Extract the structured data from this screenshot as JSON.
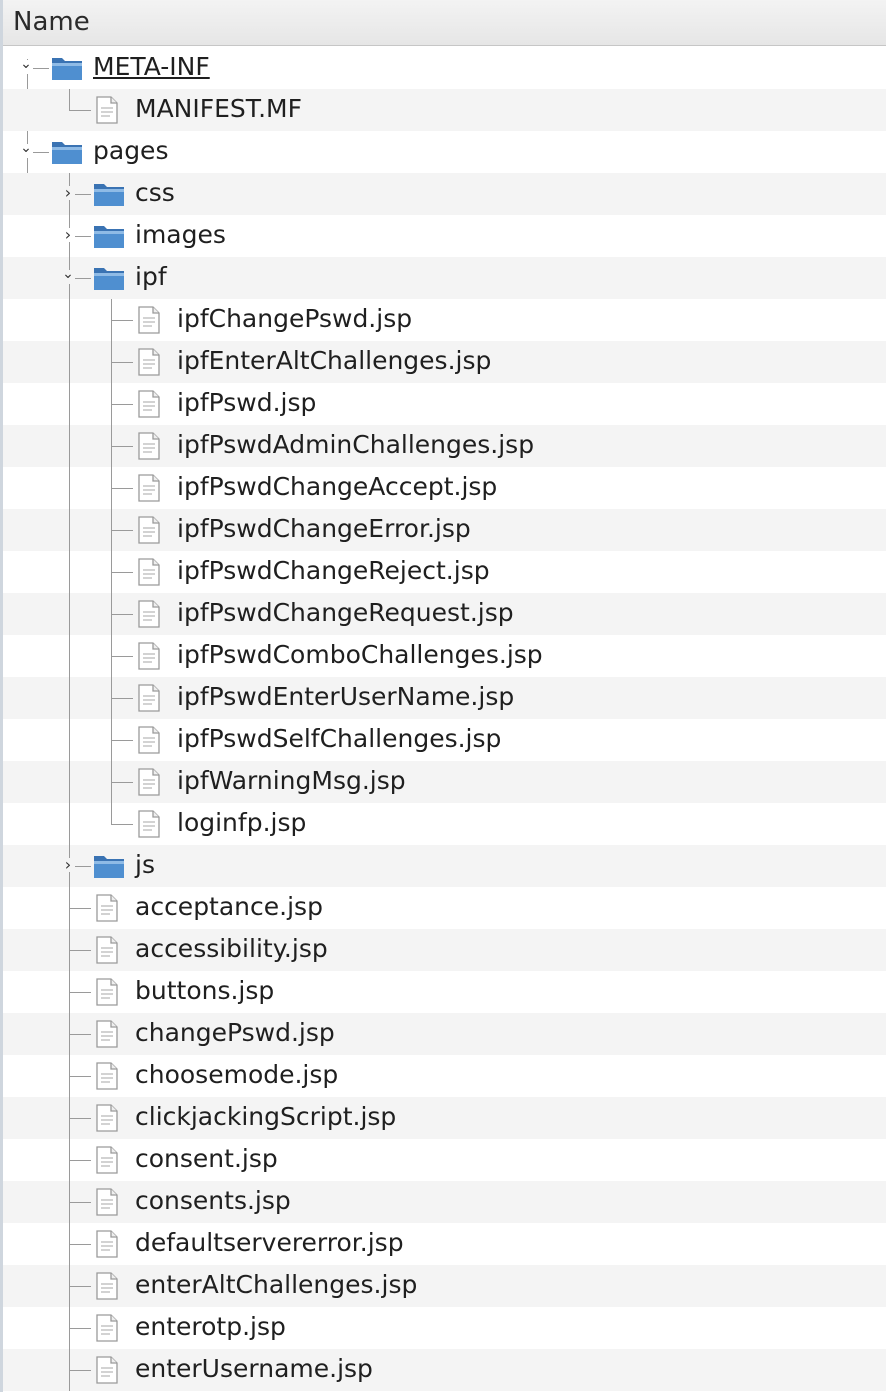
{
  "header": {
    "name_label": "Name"
  },
  "colors": {
    "folder": "#4f8fd0",
    "folder_tab": "#3a73b3",
    "row_alt": "#f4f4f4",
    "tree_line": "#9a9a9a"
  },
  "tree": [
    {
      "label": "META-INF",
      "type": "folder",
      "depth": 0,
      "expanded": true,
      "underline": true
    },
    {
      "label": "MANIFEST.MF",
      "type": "file",
      "depth": 1
    },
    {
      "label": "pages",
      "type": "folder",
      "depth": 0,
      "expanded": true
    },
    {
      "label": "css",
      "type": "folder",
      "depth": 1,
      "expanded": false
    },
    {
      "label": "images",
      "type": "folder",
      "depth": 1,
      "expanded": false
    },
    {
      "label": "ipf",
      "type": "folder",
      "depth": 1,
      "expanded": true
    },
    {
      "label": "ipfChangePswd.jsp",
      "type": "file",
      "depth": 2
    },
    {
      "label": "ipfEnterAltChallenges.jsp",
      "type": "file",
      "depth": 2
    },
    {
      "label": "ipfPswd.jsp",
      "type": "file",
      "depth": 2
    },
    {
      "label": "ipfPswdAdminChallenges.jsp",
      "type": "file",
      "depth": 2
    },
    {
      "label": "ipfPswdChangeAccept.jsp",
      "type": "file",
      "depth": 2
    },
    {
      "label": "ipfPswdChangeError.jsp",
      "type": "file",
      "depth": 2
    },
    {
      "label": "ipfPswdChangeReject.jsp",
      "type": "file",
      "depth": 2
    },
    {
      "label": "ipfPswdChangeRequest.jsp",
      "type": "file",
      "depth": 2
    },
    {
      "label": "ipfPswdComboChallenges.jsp",
      "type": "file",
      "depth": 2
    },
    {
      "label": "ipfPswdEnterUserName.jsp",
      "type": "file",
      "depth": 2
    },
    {
      "label": "ipfPswdSelfChallenges.jsp",
      "type": "file",
      "depth": 2
    },
    {
      "label": "ipfWarningMsg.jsp",
      "type": "file",
      "depth": 2
    },
    {
      "label": "loginfp.jsp",
      "type": "file",
      "depth": 2
    },
    {
      "label": "js",
      "type": "folder",
      "depth": 1,
      "expanded": false
    },
    {
      "label": "acceptance.jsp",
      "type": "file",
      "depth": 1
    },
    {
      "label": "accessibility.jsp",
      "type": "file",
      "depth": 1
    },
    {
      "label": "buttons.jsp",
      "type": "file",
      "depth": 1
    },
    {
      "label": "changePswd.jsp",
      "type": "file",
      "depth": 1
    },
    {
      "label": "choosemode.jsp",
      "type": "file",
      "depth": 1
    },
    {
      "label": "clickjackingScript.jsp",
      "type": "file",
      "depth": 1
    },
    {
      "label": "consent.jsp",
      "type": "file",
      "depth": 1
    },
    {
      "label": "consents.jsp",
      "type": "file",
      "depth": 1
    },
    {
      "label": "defaultservererror.jsp",
      "type": "file",
      "depth": 1
    },
    {
      "label": "enterAltChallenges.jsp",
      "type": "file",
      "depth": 1
    },
    {
      "label": "enterotp.jsp",
      "type": "file",
      "depth": 1
    },
    {
      "label": "enterUsername.jsp",
      "type": "file",
      "depth": 1
    }
  ]
}
